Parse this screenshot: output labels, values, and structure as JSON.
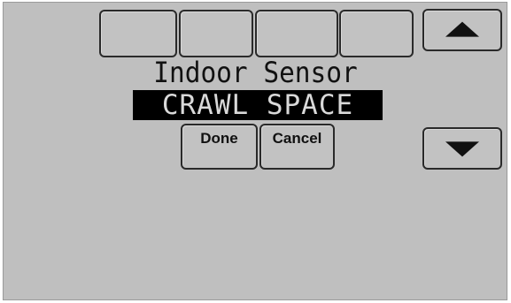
{
  "screen": {
    "label": "Indoor Sensor",
    "value": "CRAWL SPACE"
  },
  "buttons": {
    "done_label": "Done",
    "cancel_label": "Cancel"
  },
  "icons": {
    "up": "up-arrow-icon",
    "down": "down-arrow-icon"
  },
  "colors": {
    "screen_background": "#bfbfbf",
    "highlight_background": "#000000",
    "highlight_text": "#d9d9d9"
  }
}
